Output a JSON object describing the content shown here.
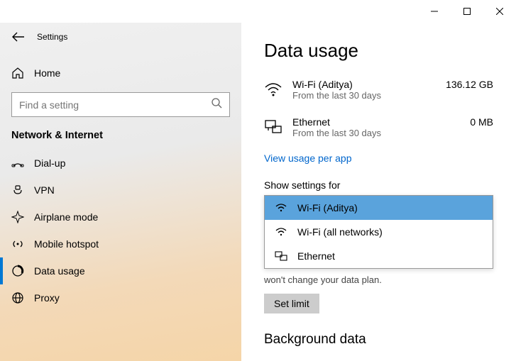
{
  "titlebar": {
    "settings": "Settings"
  },
  "sidebar": {
    "home": "Home",
    "search_placeholder": "Find a setting",
    "section": "Network & Internet",
    "items": [
      {
        "label": "Dial-up"
      },
      {
        "label": "VPN"
      },
      {
        "label": "Airplane mode"
      },
      {
        "label": "Mobile hotspot"
      },
      {
        "label": "Data usage"
      },
      {
        "label": "Proxy"
      }
    ]
  },
  "main": {
    "title": "Data usage",
    "usage": [
      {
        "name": "Wi-Fi (Aditya)",
        "sub": "From the last 30 days",
        "value": "136.12 GB"
      },
      {
        "name": "Ethernet",
        "sub": "From the last 30 days",
        "value": "0 MB"
      }
    ],
    "link": "View usage per app",
    "show_settings_label": "Show settings for",
    "dd": [
      {
        "label": "Wi-Fi (Aditya)"
      },
      {
        "label": "Wi-Fi (all networks)"
      },
      {
        "label": "Ethernet"
      }
    ],
    "hint": "won't change your data plan.",
    "set_limit": "Set limit",
    "bg_heading": "Background data"
  }
}
